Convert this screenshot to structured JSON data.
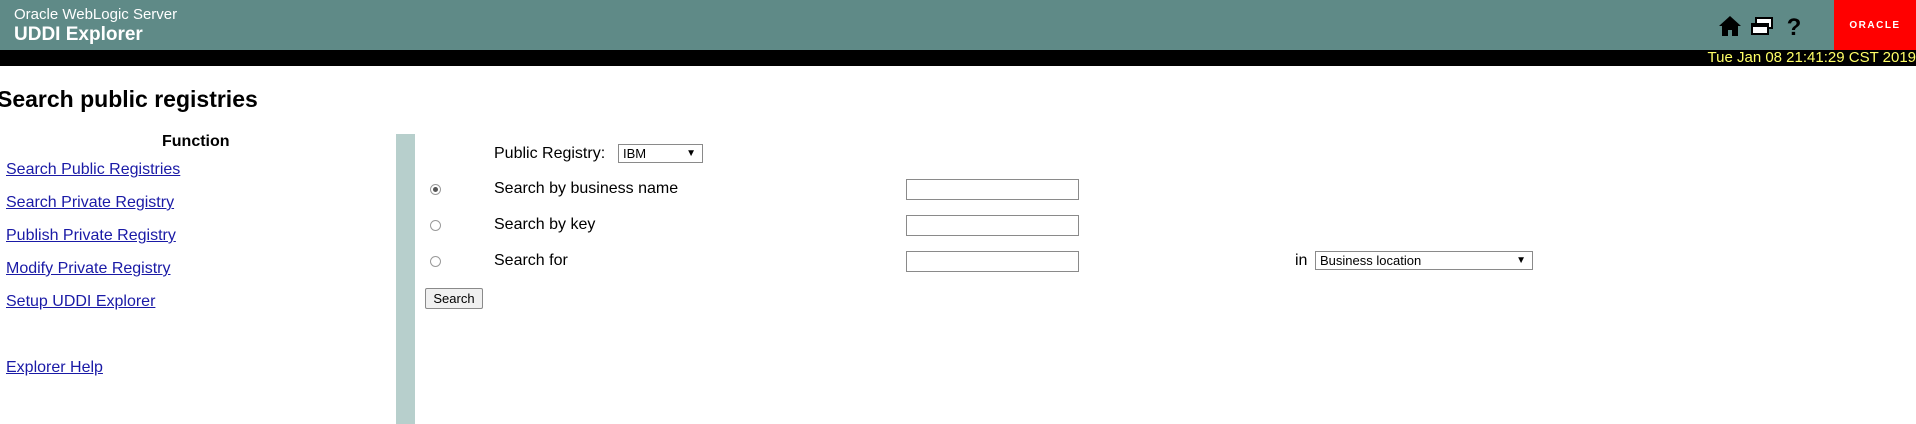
{
  "header": {
    "product": "Oracle WebLogic Server",
    "app_title": "UDDI Explorer",
    "icons": [
      "home-icon",
      "windows-icon",
      "help-icon"
    ],
    "logo_text": "ORACLE",
    "background_color": "#5f8a87",
    "logo_color": "#ff0000"
  },
  "datebar": {
    "date": "Tue Jan 08 21:41:29 CST 2019",
    "text_color": "#ffff66"
  },
  "page_title": "Search public registries",
  "sidebar": {
    "heading": "Function",
    "items": [
      {
        "label": "Search Public Registries"
      },
      {
        "label": "Search Private Registry"
      },
      {
        "label": "Publish Private Registry"
      },
      {
        "label": "Modify Private Registry"
      },
      {
        "label": "Setup UDDI Explorer"
      },
      {
        "label": "Explorer Help"
      }
    ]
  },
  "form": {
    "registry_label": "Public Registry:",
    "registry_value": "IBM",
    "options": [
      {
        "label": "Search by business name",
        "selected": true,
        "value": ""
      },
      {
        "label": "Search by key",
        "selected": false,
        "value": ""
      },
      {
        "label": "Search for",
        "selected": false,
        "value": ""
      }
    ],
    "in_label": "in",
    "in_select_value": "Business location",
    "search_button": "Search"
  }
}
